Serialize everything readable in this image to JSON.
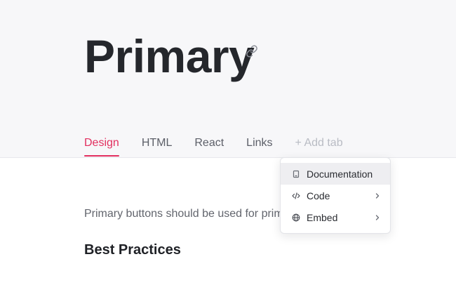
{
  "page": {
    "title": "Primary"
  },
  "tabs": [
    {
      "label": "Design",
      "active": true
    },
    {
      "label": "HTML",
      "active": false
    },
    {
      "label": "React",
      "active": false
    },
    {
      "label": "Links",
      "active": false
    }
  ],
  "add_tab_label": "+ Add tab",
  "menu": {
    "items": [
      {
        "label": "Documentation",
        "icon": "document-icon",
        "has_submenu": false,
        "hovered": true
      },
      {
        "label": "Code",
        "icon": "code-icon",
        "has_submenu": true,
        "hovered": false
      },
      {
        "label": "Embed",
        "icon": "globe-icon",
        "has_submenu": true,
        "hovered": false
      }
    ]
  },
  "content": {
    "intro_text": "Primary buttons should be used for prim",
    "section_heading": "Best Practices"
  },
  "colors": {
    "accent": "#e22f5f",
    "hero_background": "#f7f7f9"
  }
}
